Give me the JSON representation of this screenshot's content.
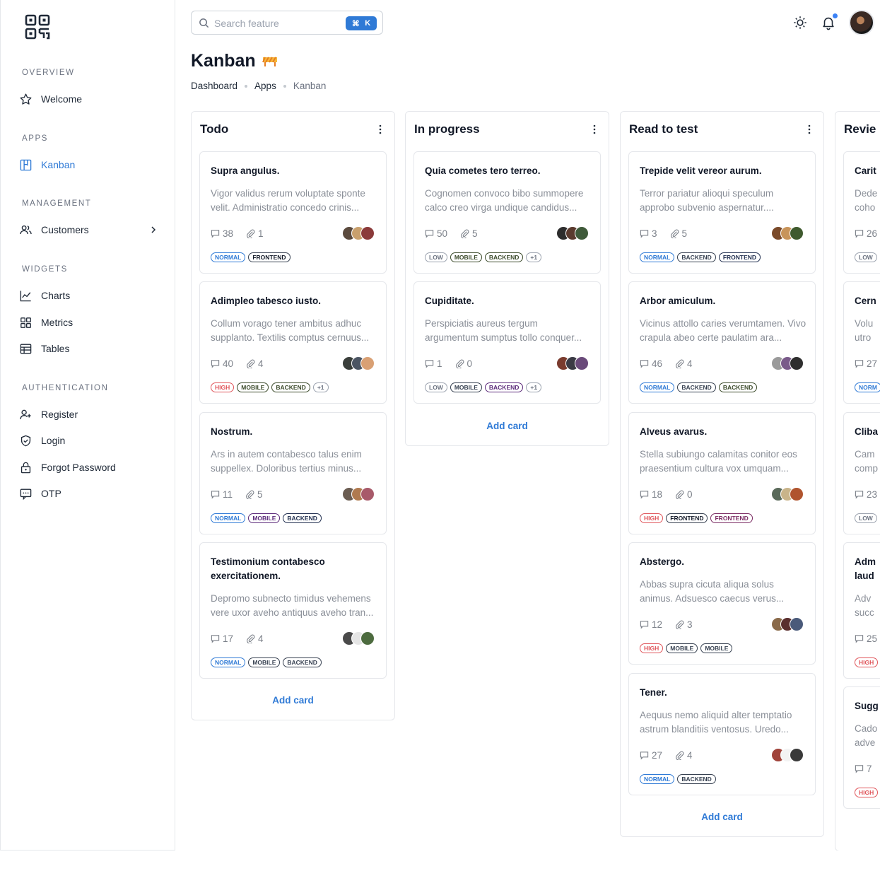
{
  "sidebar": {
    "sections": {
      "overview": "OVERVIEW",
      "apps": "APPS",
      "management": "MANAGEMENT",
      "widgets": "WIDGETS",
      "authentication": "AUTHENTICATION"
    },
    "items": {
      "welcome": "Welcome",
      "kanban": "Kanban",
      "customers": "Customers",
      "charts": "Charts",
      "metrics": "Metrics",
      "tables": "Tables",
      "register": "Register",
      "login": "Login",
      "forgot": "Forgot Password",
      "otp": "OTP"
    },
    "active_color": "#2f7ad6"
  },
  "header": {
    "search_placeholder": "Search feature",
    "shortcut_symbol": "⌘",
    "shortcut_key": "K",
    "icons": [
      "sun-icon",
      "bell-icon",
      "user-avatar"
    ]
  },
  "page": {
    "title": "Kanban",
    "breadcrumb": [
      "Dashboard",
      "Apps",
      "Kanban"
    ]
  },
  "columns": [
    {
      "name": "Todo",
      "add_label": "Add card",
      "cards": [
        {
          "title": "Supra angulus.",
          "desc": "Vigor validus rerum voluptate sponte velit. Administratio concedo crinis...",
          "comments": "38",
          "attachments": "1",
          "tags": [
            "NORMAL",
            "FRONTEND"
          ]
        },
        {
          "title": "Adimpleo tabesco iusto.",
          "desc": "Collum vorago tener ambitus adhuc supplanto. Textilis comptus cernuus...",
          "comments": "40",
          "attachments": "4",
          "tags": [
            "HIGH",
            "MOBILE",
            "BACKEND",
            "+1"
          ]
        },
        {
          "title": "Nostrum.",
          "desc": "Ars in autem contabesco talus enim suppellex. Doloribus tertius minus...",
          "comments": "11",
          "attachments": "5",
          "tags": [
            "NORMAL",
            "MOBILE",
            "BACKEND"
          ]
        },
        {
          "title": "Testimonium contabesco exercitationem.",
          "desc": "Depromo subnecto timidus vehemens vere uxor aveho antiquus aveho tran...",
          "comments": "17",
          "attachments": "4",
          "tags": [
            "NORMAL",
            "MOBILE",
            "BACKEND"
          ]
        }
      ]
    },
    {
      "name": "In progress",
      "add_label": "Add card",
      "cards": [
        {
          "title": "Quia cometes tero terreo.",
          "desc": "Cognomen convoco bibo summopere calco creo virga undique candidus...",
          "comments": "50",
          "attachments": "5",
          "tags": [
            "LOW",
            "MOBILE",
            "BACKEND",
            "+1"
          ]
        },
        {
          "title": "Cupiditate.",
          "desc": "Perspiciatis aureus tergum argumentum sumptus tollo conquer...",
          "comments": "1",
          "attachments": "0",
          "tags": [
            "LOW",
            "MOBILE",
            "BACKEND",
            "+1"
          ]
        }
      ]
    },
    {
      "name": "Read to test",
      "add_label": "Add card",
      "cards": [
        {
          "title": "Trepide velit vereor aurum.",
          "desc": "Terror pariatur alioqui speculum approbo subvenio aspernatur....",
          "comments": "3",
          "attachments": "5",
          "tags": [
            "NORMAL",
            "BACKEND",
            "FRONTEND"
          ]
        },
        {
          "title": "Arbor amiculum.",
          "desc": "Vicinus attollo caries verumtamen. Vivo crapula abeo certe paulatim ara...",
          "comments": "46",
          "attachments": "4",
          "tags": [
            "NORMAL",
            "BACKEND",
            "BACKEND"
          ]
        },
        {
          "title": "Alveus avarus.",
          "desc": "Stella subiungo calamitas conitor eos praesentium cultura vox umquam...",
          "comments": "18",
          "attachments": "0",
          "tags": [
            "HIGH",
            "FRONTEND",
            "FRONTEND"
          ]
        },
        {
          "title": "Abstergo.",
          "desc": "Abbas supra cicuta aliqua solus animus. Adsuesco caecus verus...",
          "comments": "12",
          "attachments": "3",
          "tags": [
            "HIGH",
            "MOBILE",
            "MOBILE"
          ]
        },
        {
          "title": "Tener.",
          "desc": "Aequus nemo aliquid alter temptatio astrum blanditiis ventosus. Uredo...",
          "comments": "27",
          "attachments": "4",
          "tags": [
            "NORMAL",
            "BACKEND"
          ]
        }
      ]
    },
    {
      "name": "Revie",
      "cards": [
        {
          "title": "Carit",
          "desc1": "Dede",
          "desc2": "coho",
          "comments": "26",
          "tag": "LOW"
        },
        {
          "title": "Cern",
          "desc1": "Volu",
          "desc2": "utro",
          "comments": "27",
          "tag": "NORM"
        },
        {
          "title": "Cliba",
          "desc1": "Cam",
          "desc2": "comp",
          "comments": "23",
          "tag": "LOW"
        },
        {
          "title": "Adm",
          "title2": "laud",
          "desc1": "Adv",
          "desc2": "succ",
          "comments": "25",
          "tag": "HIGH"
        },
        {
          "title": "Sugg",
          "desc1": "Cado",
          "desc2": "adve",
          "comments": "7",
          "tag": "HIGH"
        }
      ]
    }
  ]
}
